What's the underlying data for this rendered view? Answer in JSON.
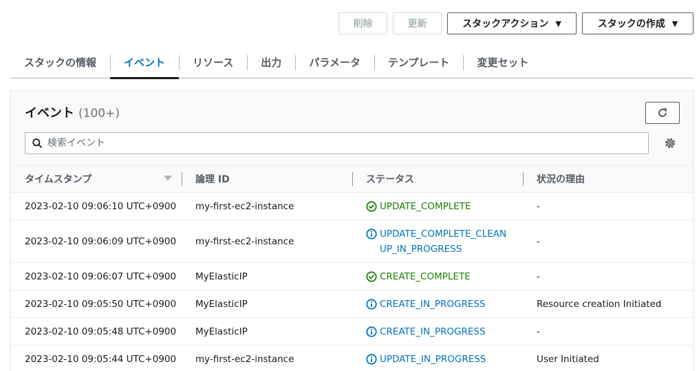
{
  "header": {
    "delete_label": "削除",
    "update_label": "更新",
    "stack_actions_label": "スタックアクション",
    "create_stack_label": "スタックの作成"
  },
  "tabs": [
    {
      "label": "スタックの情報",
      "active": false
    },
    {
      "label": "イベント",
      "active": true
    },
    {
      "label": "リソース",
      "active": false
    },
    {
      "label": "出力",
      "active": false
    },
    {
      "label": "パラメータ",
      "active": false
    },
    {
      "label": "テンプレート",
      "active": false
    },
    {
      "label": "変更セット",
      "active": false
    }
  ],
  "events_panel": {
    "title": "イベント",
    "count": "(100+)",
    "search_placeholder": "検索イベント",
    "search_value": ""
  },
  "table": {
    "columns": [
      "タイムスタンプ",
      "論理 ID",
      "ステータス",
      "状況の理由"
    ],
    "rows": [
      {
        "timestamp": "2023-02-10 09:06:10 UTC+0900",
        "logical_id": "my-first-ec2-instance",
        "status": "UPDATE_COMPLETE",
        "status_type": "success",
        "reason": "-"
      },
      {
        "timestamp": "2023-02-10 09:06:09 UTC+0900",
        "logical_id": "my-first-ec2-instance",
        "status": "UPDATE_COMPLETE_CLEANUP_IN_PROGRESS",
        "status_type": "info",
        "reason": "-"
      },
      {
        "timestamp": "2023-02-10 09:06:07 UTC+0900",
        "logical_id": "MyElasticIP",
        "status": "CREATE_COMPLETE",
        "status_type": "success",
        "reason": "-"
      },
      {
        "timestamp": "2023-02-10 09:05:50 UTC+0900",
        "logical_id": "MyElasticIP",
        "status": "CREATE_IN_PROGRESS",
        "status_type": "info",
        "reason": "Resource creation Initiated"
      },
      {
        "timestamp": "2023-02-10 09:05:48 UTC+0900",
        "logical_id": "MyElasticIP",
        "status": "CREATE_IN_PROGRESS",
        "status_type": "info",
        "reason": "-"
      },
      {
        "timestamp": "2023-02-10 09:05:44 UTC+0900",
        "logical_id": "my-first-ec2-instance",
        "status": "UPDATE_IN_PROGRESS",
        "status_type": "info",
        "reason": "User Initiated"
      }
    ]
  },
  "icons": {
    "refresh": "refresh-icon",
    "search": "search-icon",
    "settings": "gear-icon",
    "success": "check-circle-icon",
    "info": "info-circle-icon",
    "sort": "sort-down-icon"
  },
  "colors": {
    "accent": "#0073bb",
    "success": "#1d8102",
    "info": "#0073bb",
    "text": "#16191f",
    "muted": "#545b64"
  }
}
